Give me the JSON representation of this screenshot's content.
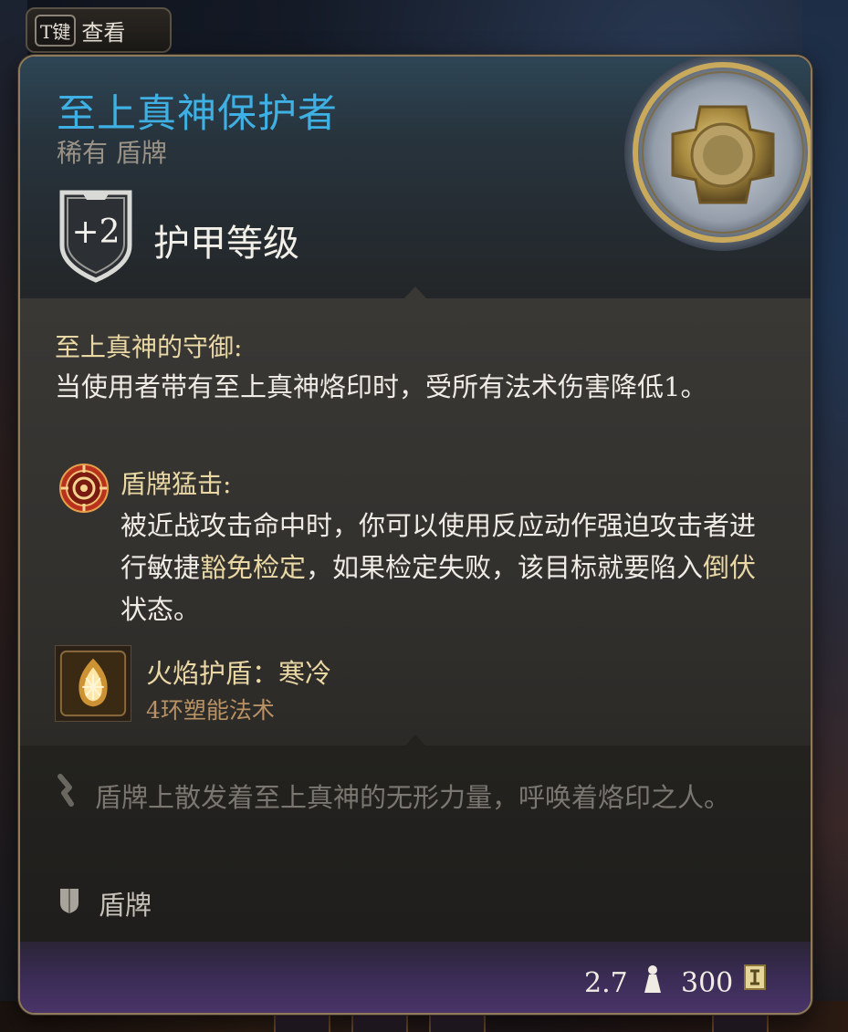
{
  "view_hint": {
    "key": "T键",
    "label": "查看"
  },
  "item": {
    "name": "至上真神保护者",
    "rarity_type": "稀有 盾牌",
    "armor_class_value": "+2",
    "armor_class_label": "护甲等级",
    "passive": {
      "title": "至上真神的守御:",
      "description": "当使用者带有至上真神烙印时，受所有法术伤害降低1。"
    },
    "action": {
      "icon": "shield-bash-icon",
      "title": "盾牌猛击:",
      "desc_part1": "被近战攻击命中时，你可以使用反应动作强迫攻击者进行敏捷",
      "desc_kw1": "豁免检定",
      "desc_part2": "，如果检定失败，该目标就要陷入",
      "desc_kw2": "倒伏",
      "desc_part3": "状态。"
    },
    "spell": {
      "icon": "fire-shield-icon",
      "name": "火焰护盾：寒冷",
      "level": "4环塑能法术"
    },
    "lore": "盾牌上散发着至上真神的无形力量，呼唤着烙印之人。",
    "item_type": "盾牌",
    "weight": "2.7",
    "price": "300"
  },
  "colors": {
    "title": "#3fb0e4",
    "keyword": "#e9d7a4",
    "border": "#8f7a5c"
  }
}
